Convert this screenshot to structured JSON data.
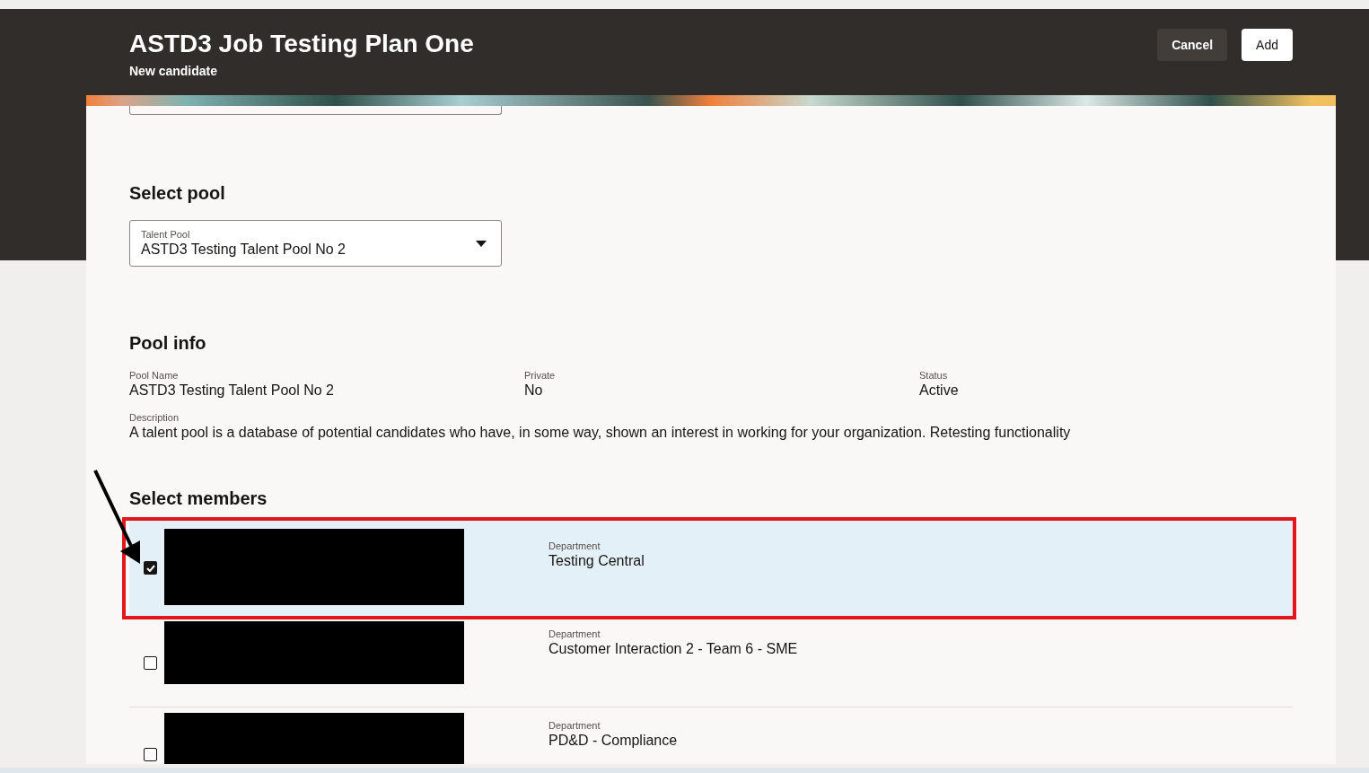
{
  "header": {
    "title": "ASTD3 Job Testing Plan One",
    "subtitle": "New candidate",
    "buttons": [
      {
        "label": "Cancel",
        "kind": "secondary"
      },
      {
        "label": "Add",
        "kind": "primary"
      }
    ]
  },
  "pool_select": {
    "heading": "Select pool",
    "field": {
      "label": "Talent Pool",
      "value": "ASTD3 Testing Talent Pool No 2"
    }
  },
  "pool_info": {
    "heading": "Pool info",
    "fields": [
      {
        "label": "Pool Name",
        "value": "ASTD3 Testing Talent Pool No 2"
      },
      {
        "label": "Private",
        "value": "No"
      },
      {
        "label": "Status",
        "value": "Active"
      }
    ],
    "description": {
      "label": "Description",
      "value": "A talent pool is a database of potential candidates who have, in some way, shown an interest in working for your organization. Retesting functionality"
    }
  },
  "members": {
    "heading": "Select members",
    "rows": [
      {
        "checked": true,
        "selected": true,
        "annotated": true,
        "field_label": "Department",
        "department": "Testing Central"
      },
      {
        "checked": false,
        "selected": false,
        "annotated": false,
        "field_label": "Department",
        "department": "Customer Interaction 2 - Team 6 - SME"
      },
      {
        "checked": false,
        "selected": false,
        "annotated": false,
        "field_label": "Department",
        "department": "PD&D - Compliance"
      }
    ]
  }
}
